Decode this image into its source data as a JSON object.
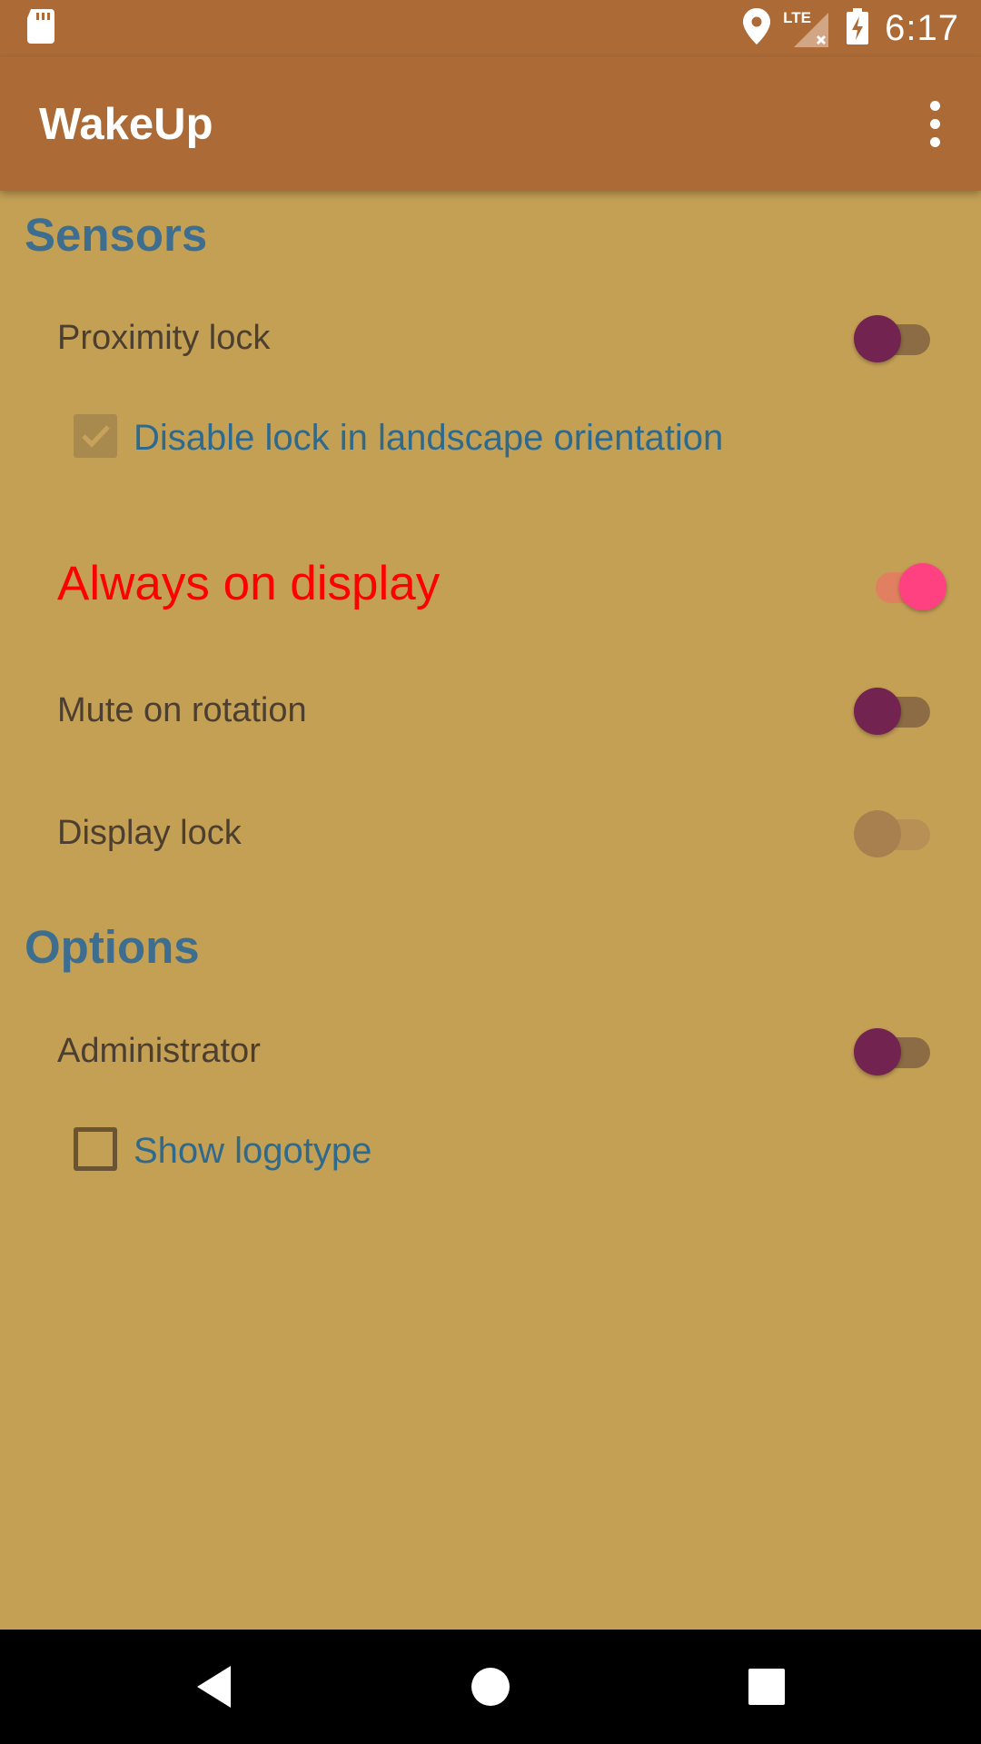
{
  "status_bar": {
    "time": "6:17",
    "network_label": "LTE",
    "icons": [
      "sd-card-icon",
      "location-pin-icon",
      "signal-no-service-icon",
      "battery-charging-icon"
    ]
  },
  "app_bar": {
    "title": "WakeUp",
    "overflow_icon": "more-vert-icon"
  },
  "colors": {
    "primary": "#ab6a36",
    "background": "#c4a055",
    "category_text": "#3d6e8f",
    "highlight_text": "#ff0000",
    "switch_on": "#ff4081",
    "switch_off": "#722350"
  },
  "sensors": {
    "title": "Sensors",
    "proximity_lock": {
      "label": "Proximity lock",
      "checked": false
    },
    "disable_landscape": {
      "label": "Disable lock in landscape orientation",
      "checked": true,
      "enabled": false
    },
    "always_on": {
      "label": "Always on display",
      "checked": true
    },
    "mute_rotation": {
      "label": "Mute on rotation",
      "checked": false
    },
    "display_lock": {
      "label": "Display lock",
      "checked": false,
      "enabled": false
    }
  },
  "options": {
    "title": "Options",
    "administrator": {
      "label": "Administrator",
      "checked": false
    },
    "show_logotype": {
      "label": "Show logotype",
      "checked": false
    }
  },
  "nav_bar": {
    "back_icon": "back-triangle-icon",
    "home_icon": "home-circle-icon",
    "recents_icon": "recents-square-icon"
  }
}
